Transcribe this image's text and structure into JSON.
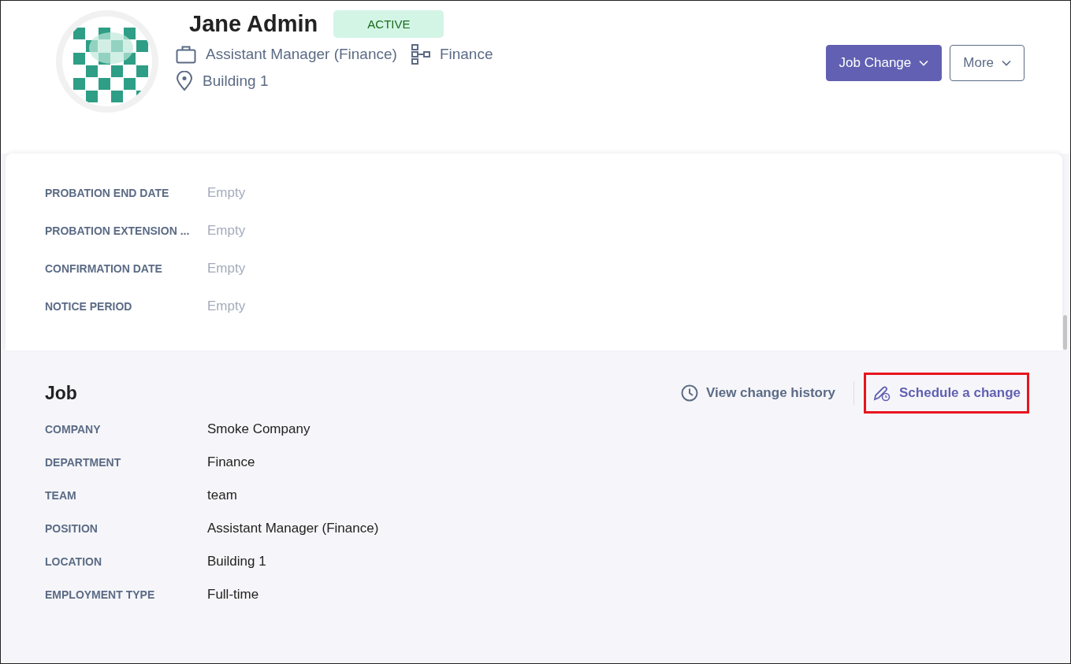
{
  "profile": {
    "name": "Jane Admin",
    "status": "ACTIVE",
    "position": "Assistant Manager (Finance)",
    "department": "Finance",
    "location": "Building 1"
  },
  "actions": [
    {
      "label": "Job Change",
      "kind": "primary"
    },
    {
      "label": "More",
      "kind": "secondary"
    }
  ],
  "probation_fields": [
    {
      "label": "PROBATION END DATE",
      "value": "Empty"
    },
    {
      "label": "PROBATION EXTENSION ...",
      "value": "Empty"
    },
    {
      "label": "CONFIRMATION DATE",
      "value": "Empty"
    },
    {
      "label": "NOTICE PERIOD",
      "value": "Empty"
    }
  ],
  "job": {
    "title": "Job",
    "links": [
      {
        "label": "View change history",
        "kind": "history",
        "highlighted": false
      },
      {
        "label": "Schedule a change",
        "kind": "schedule",
        "highlighted": true
      }
    ],
    "fields": [
      {
        "label": "COMPANY",
        "value": "Smoke Company"
      },
      {
        "label": "DEPARTMENT",
        "value": "Finance"
      },
      {
        "label": "TEAM",
        "value": "team"
      },
      {
        "label": "POSITION",
        "value": "Assistant Manager (Finance)"
      },
      {
        "label": "LOCATION",
        "value": "Building 1"
      },
      {
        "label": "EMPLOYMENT TYPE",
        "value": "Full-time"
      }
    ]
  }
}
